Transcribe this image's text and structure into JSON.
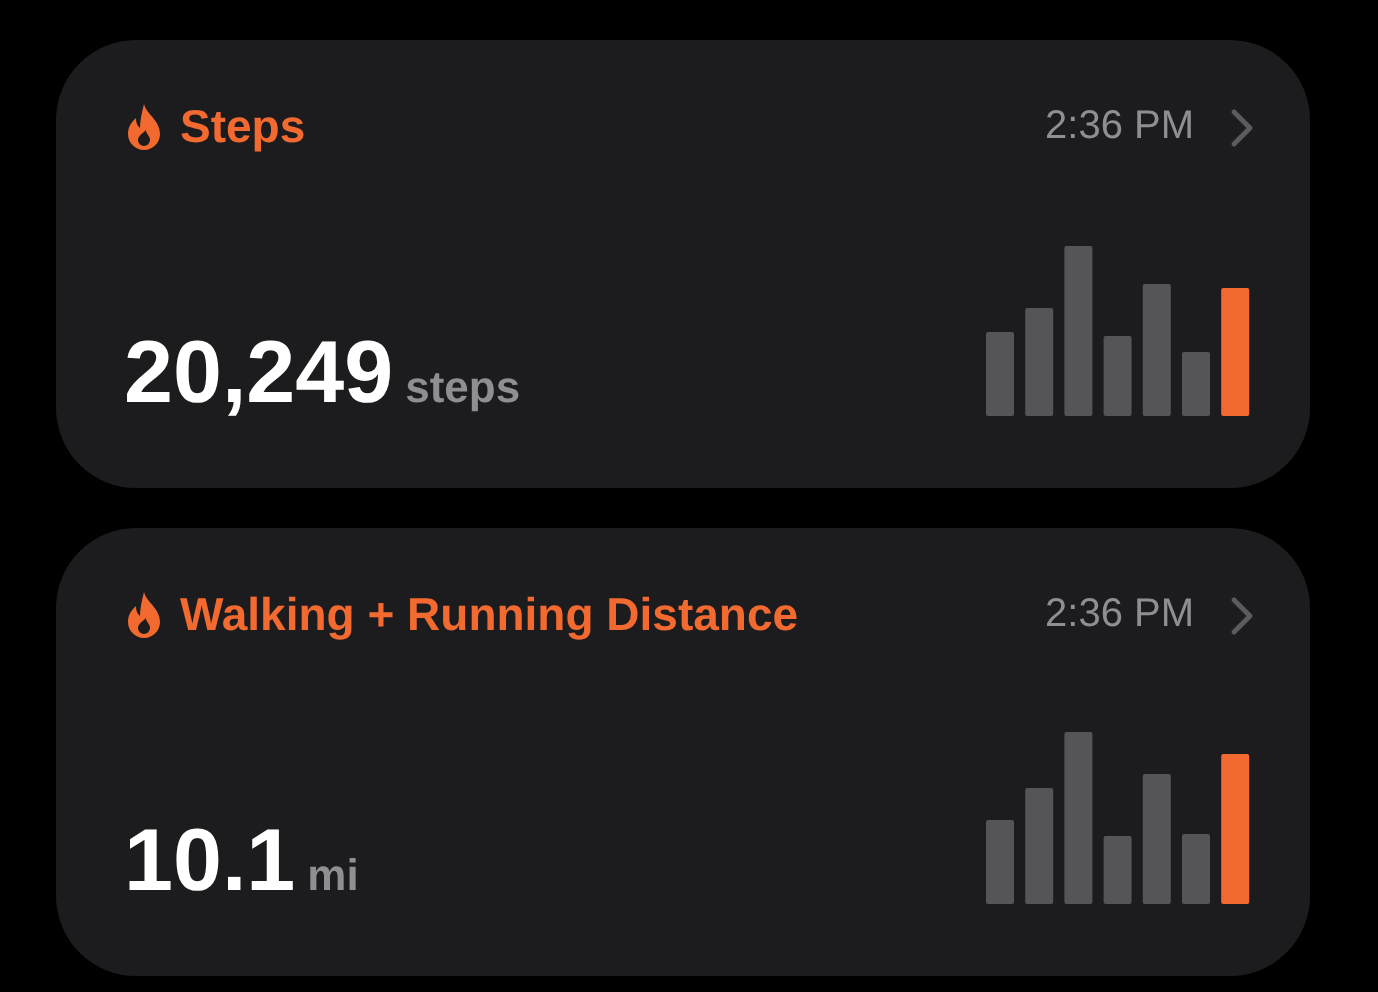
{
  "cards": [
    {
      "title": "Steps",
      "time": "2:36 PM",
      "value": "20,249",
      "unit": "steps"
    },
    {
      "title": "Walking + Running Distance",
      "time": "2:36 PM",
      "value": "10.1",
      "unit": "mi"
    }
  ]
}
